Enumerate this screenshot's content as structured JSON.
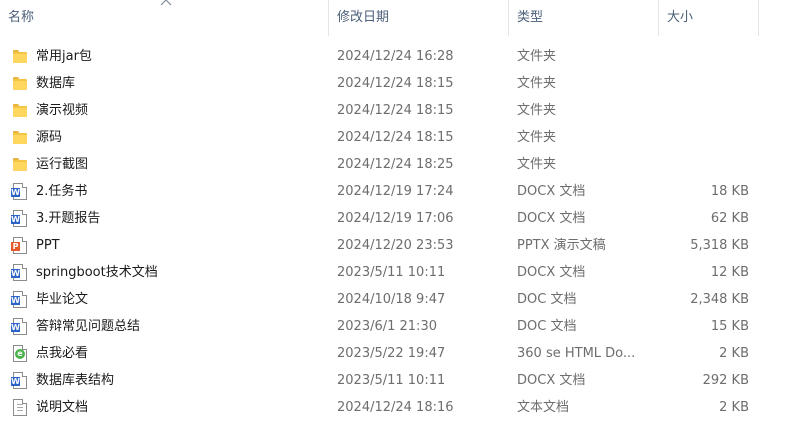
{
  "columns": {
    "name": "名称",
    "modified": "修改日期",
    "type": "类型",
    "size": "大小"
  },
  "sort_indicator": "ascending",
  "files": [
    {
      "name": "常用jar包",
      "modified": "2024/12/24 16:28",
      "type": "文件夹",
      "size": "",
      "icon": "folder-icon"
    },
    {
      "name": "数据库",
      "modified": "2024/12/24 18:15",
      "type": "文件夹",
      "size": "",
      "icon": "folder-icon"
    },
    {
      "name": "演示视频",
      "modified": "2024/12/24 18:15",
      "type": "文件夹",
      "size": "",
      "icon": "folder-icon"
    },
    {
      "name": "源码",
      "modified": "2024/12/24 18:15",
      "type": "文件夹",
      "size": "",
      "icon": "folder-icon"
    },
    {
      "name": "运行截图",
      "modified": "2024/12/24 18:25",
      "type": "文件夹",
      "size": "",
      "icon": "folder-icon"
    },
    {
      "name": "2.任务书",
      "modified": "2024/12/19 17:24",
      "type": "DOCX 文档",
      "size": "18 KB",
      "icon": "word-doc-icon"
    },
    {
      "name": "3.开题报告",
      "modified": "2024/12/19 17:06",
      "type": "DOCX 文档",
      "size": "62 KB",
      "icon": "word-doc-icon"
    },
    {
      "name": "PPT",
      "modified": "2024/12/20 23:53",
      "type": "PPTX 演示文稿",
      "size": "5,318 KB",
      "icon": "powerpoint-icon"
    },
    {
      "name": "springboot技术文档",
      "modified": "2023/5/11 10:11",
      "type": "DOCX 文档",
      "size": "12 KB",
      "icon": "word-doc-icon"
    },
    {
      "name": "毕业论文",
      "modified": "2024/10/18 9:47",
      "type": "DOC 文档",
      "size": "2,348 KB",
      "icon": "word-doc-icon"
    },
    {
      "name": "答辩常见问题总结",
      "modified": "2023/6/1 21:30",
      "type": "DOC 文档",
      "size": "15 KB",
      "icon": "word-doc-icon"
    },
    {
      "name": "点我必看",
      "modified": "2023/5/22 19:47",
      "type": "360 se HTML Do...",
      "size": "2 KB",
      "icon": "html-file-icon"
    },
    {
      "name": "数据库表结构",
      "modified": "2023/5/11 10:11",
      "type": "DOCX 文档",
      "size": "292 KB",
      "icon": "word-doc-icon"
    },
    {
      "name": "说明文档",
      "modified": "2024/12/24 18:16",
      "type": "文本文档",
      "size": "2 KB",
      "icon": "text-file-icon"
    }
  ]
}
